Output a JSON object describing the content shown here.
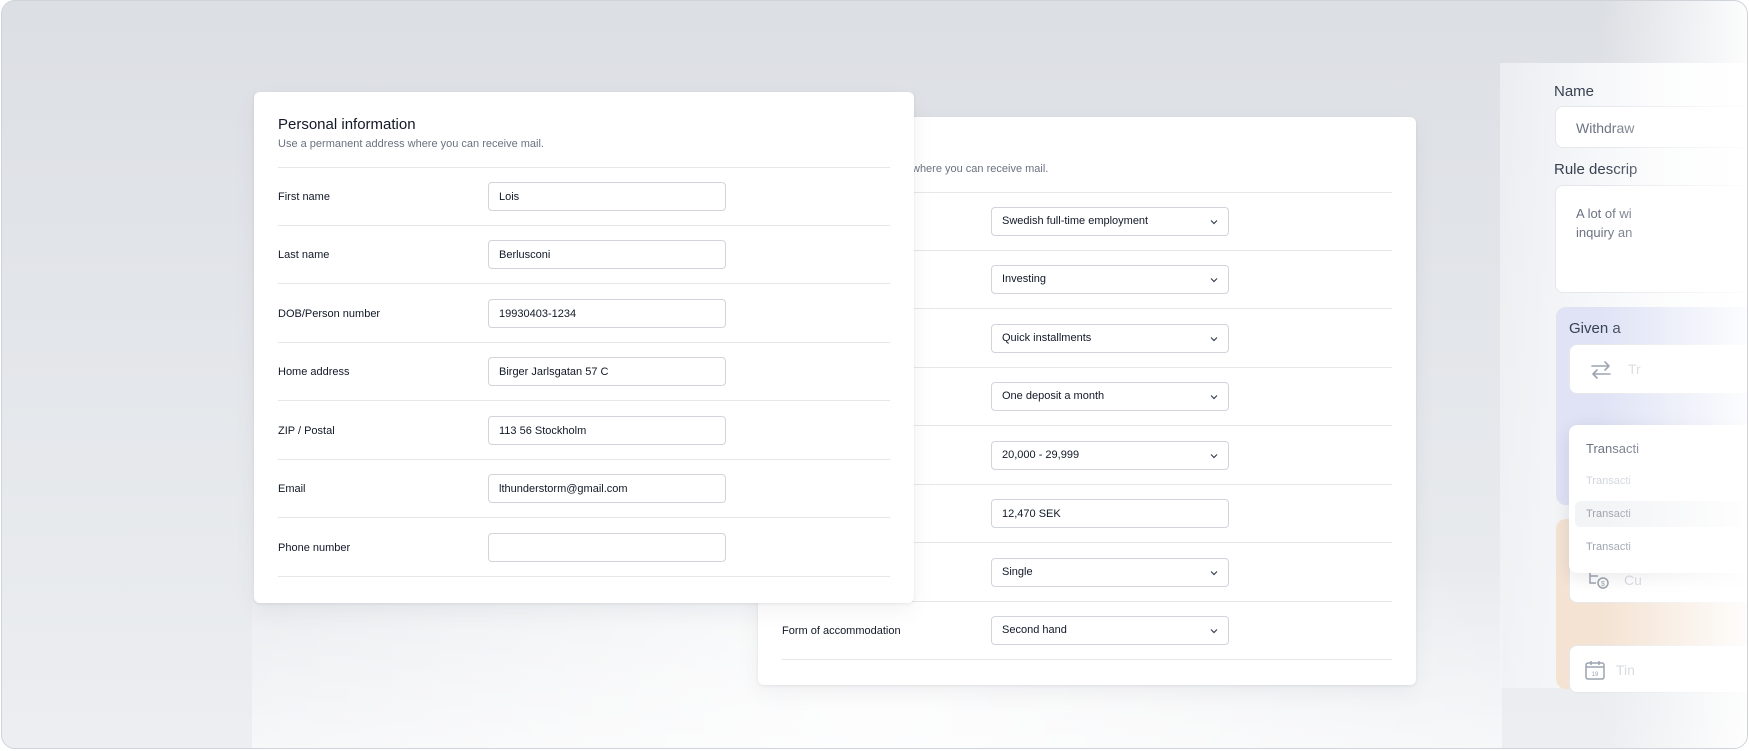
{
  "front_card": {
    "title": "Personal information",
    "subtitle": "Use a permanent address where you can receive mail.",
    "fields": [
      {
        "label": "First name",
        "value": "Lois"
      },
      {
        "label": "Last name",
        "value": "Berlusconi"
      },
      {
        "label": "DOB/Person number",
        "value": "19930403-1234"
      },
      {
        "label": "Home address",
        "value": "Birger Jarlsgatan 57 C"
      },
      {
        "label": "ZIP / Postal",
        "value": "113 56 Stockholm"
      },
      {
        "label": "Email",
        "value": "lthunderstorm@gmail.com"
      },
      {
        "label": "Phone number",
        "value": ""
      }
    ]
  },
  "back_card": {
    "subtitle_partial": "where you can receive mail.",
    "fields": [
      {
        "label": "",
        "value": "Swedish full-time employment",
        "kind": "select"
      },
      {
        "label": "",
        "value": "Investing",
        "kind": "select"
      },
      {
        "label": "",
        "value": "Quick installments",
        "kind": "select"
      },
      {
        "label": "",
        "value": "One deposit a month",
        "kind": "select"
      },
      {
        "label": "",
        "value": "20,000 - 29,999",
        "kind": "select"
      },
      {
        "label": "",
        "value": "12,470 SEK",
        "kind": "input"
      },
      {
        "label": "",
        "value": "Single",
        "kind": "select"
      },
      {
        "label": "Form of accommodation",
        "value": "Second hand",
        "kind": "select"
      }
    ]
  },
  "side_panel": {
    "name_label": "Name",
    "name_value": "Withdraw",
    "rule_label": "Rule descrip",
    "rule_text_line1": "A lot of wi",
    "rule_text_line2": "inquiry an",
    "given_label": "Given a",
    "given_item": "Tr",
    "dropdown_items": [
      "Transacti",
      "Transacti",
      "Transacti",
      "Transacti"
    ],
    "orange_item": "Cu",
    "time_item": "Tin",
    "calendar_day": "19"
  },
  "colors": {
    "accent_blue": "#dfe3f5",
    "accent_orange": "#f4e3d3",
    "border": "#d1d5db"
  }
}
